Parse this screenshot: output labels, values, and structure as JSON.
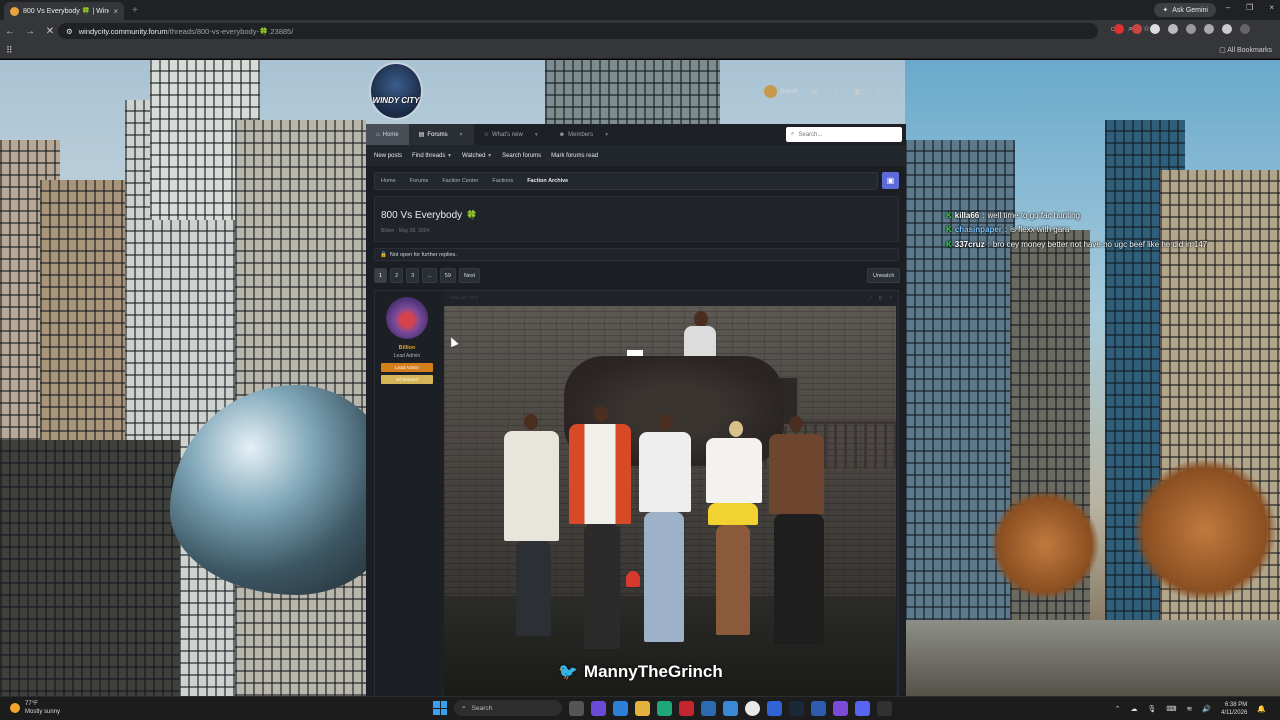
{
  "browser": {
    "tab_title": "800 Vs Everybody 🍀 | Windy C",
    "tab_close": "×",
    "new_tab": "+",
    "ask_gemini": "Ask Gemini",
    "window_controls": [
      "–",
      "❐",
      "×"
    ],
    "url_domain": "windycity.community.forum",
    "url_path": "/threads/800-vs-everybody-🍀.23885/",
    "all_bookmarks": "All Bookmarks"
  },
  "forum": {
    "logo_text": "WINDY CITY",
    "user_name": "Grinch",
    "nav": {
      "home": "Home",
      "forums": "Forums",
      "whats_new": "What's new",
      "members": "Members",
      "search_placeholder": "Search..."
    },
    "subnav": [
      "New posts",
      "Find threads",
      "Watched",
      "Search forums",
      "Mark forums read"
    ],
    "breadcrumb": [
      "Home",
      "Forums",
      "Faction Center",
      "Factions",
      "Faction Archive"
    ],
    "thread": {
      "title": "800 Vs Everybody",
      "tag": "🍀",
      "meta": "Billion · May 28, 2024"
    },
    "notice": "Not open for further replies.",
    "pagination": [
      "1",
      "2",
      "3",
      "...",
      "59",
      "Next"
    ],
    "unwatch": "Unwatch",
    "post": {
      "date": "May 28, 2024",
      "author": "Billion",
      "author_title": "Lead Admin",
      "banner1": "Lead Admin",
      "banner2": "Whitelisted"
    },
    "watermark": "MannyTheGrinch"
  },
  "chat": [
    {
      "user": "killa66",
      "message": "well time to go fac hunting",
      "color": "#ffffff"
    },
    {
      "user": "chasinpaper",
      "message": "is flexx with gara",
      "color": "#7fc8ff"
    },
    {
      "user": "337cruz",
      "message": "bro cey money better not have no ugc beef like he did in 147",
      "color": "#ffffff"
    }
  ],
  "taskbar": {
    "weather_temp": "77°F",
    "weather_desc": "Mostly sunny",
    "search": "Search",
    "time": "6:38 PM",
    "date": "4/11/2026"
  },
  "colors": {
    "accent_blue": "#5d6bd8",
    "lead_admin": "#d47e1c",
    "whitelisted": "#d6b458",
    "chat_badge": "#27d63c"
  }
}
